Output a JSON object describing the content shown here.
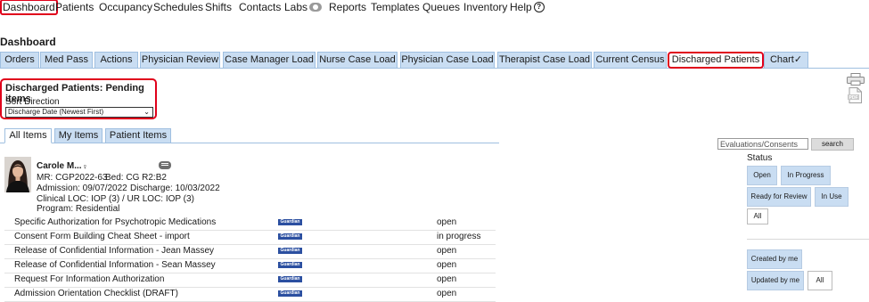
{
  "nav": {
    "items": [
      "Dashboard",
      "Patients",
      "Occupancy",
      "Schedules",
      "Shifts",
      "Contacts",
      "Labs",
      "Reports",
      "Templates",
      "Queues",
      "Inventory",
      "Help"
    ]
  },
  "page": {
    "title": "Dashboard"
  },
  "tabs": [
    "Orders",
    "Med Pass",
    "Actions",
    "Physician Review",
    "Case Manager Load",
    "Nurse Case Load",
    "Physician Case Load",
    "Therapist Case Load",
    "Current Census",
    "Discharged Patients",
    "Chart✓"
  ],
  "pending": {
    "title": "Discharged Patients: Pending items",
    "sort_label": "Sort Direction",
    "sort_value": "Discharge Date (Newest First)"
  },
  "subtabs": [
    "All Items",
    "My Items",
    "Patient Items"
  ],
  "filters": {
    "search_placeholder": "Evaluations/Consents",
    "search_button": "search",
    "status_label": "Status",
    "status_buttons": [
      "Open",
      "In Progress",
      "Ready for Review",
      "In Use",
      "All"
    ],
    "owner_buttons": [
      "Created by me",
      "Updated by me",
      "All"
    ]
  },
  "patient": {
    "name": "Carole M...",
    "mr": "MR: CGP2022-63",
    "bed": "Bed: CG R2:B2",
    "admission": "Admission: 09/07/2022",
    "discharge": "Discharge: 10/03/2022",
    "loc": "Clinical LOC: IOP (3) / UR LOC: IOP (3)",
    "program": "Program: Residential"
  },
  "items": [
    {
      "name": "Specific Authorization for Psychotropic Medications",
      "badge": "Guardian",
      "status": "open"
    },
    {
      "name": "Consent Form Building Cheat Sheet - import",
      "badge": "Guardian",
      "status": "in progress"
    },
    {
      "name": "Release of Confidential Information - Jean Massey",
      "badge": "Guardian",
      "status": "open"
    },
    {
      "name": "Release of Confidential Information - Sean Massey",
      "badge": "Guardian",
      "status": "open"
    },
    {
      "name": "Request For Information Authorization",
      "badge": "Guardian",
      "status": "open"
    },
    {
      "name": "Admission Orientation Checklist (DRAFT)",
      "badge": "Guardian",
      "status": "open"
    }
  ]
}
